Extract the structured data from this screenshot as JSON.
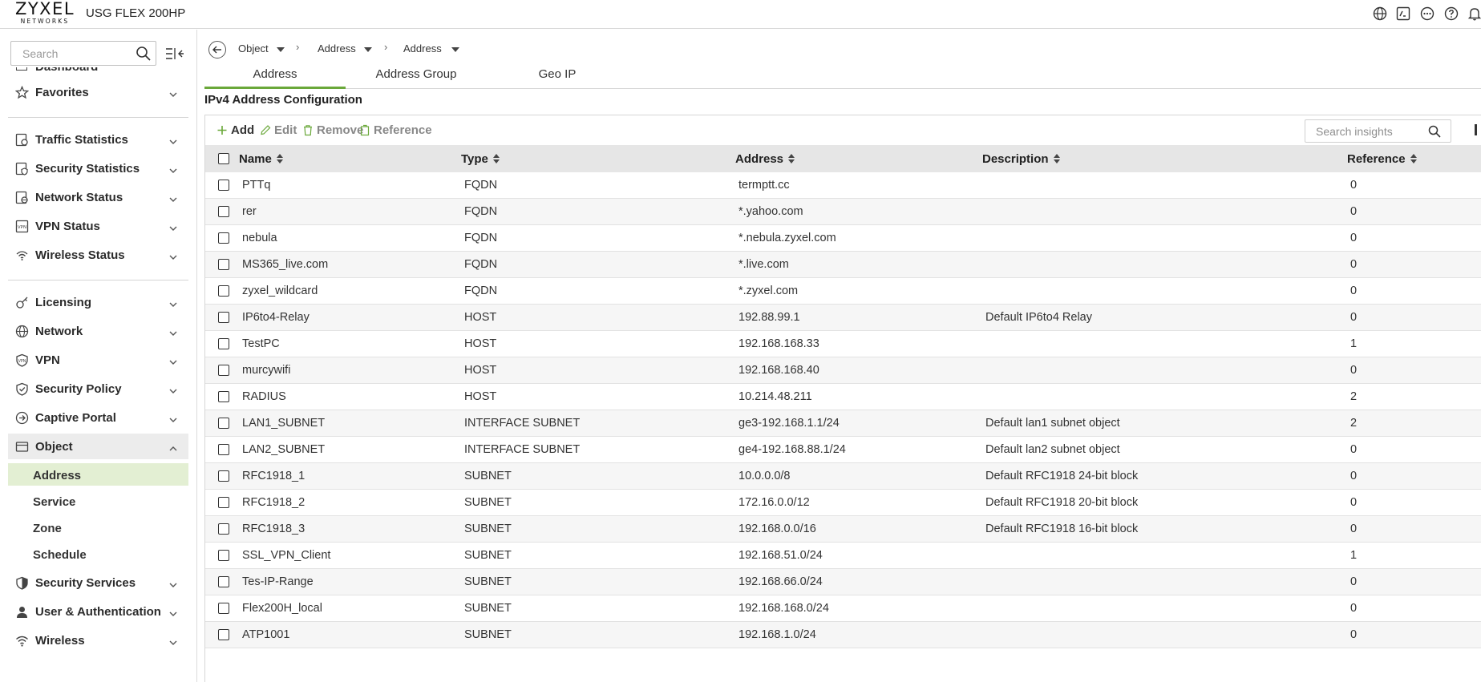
{
  "header": {
    "logo_main": "ZYXEL",
    "logo_sub": "NETWORKS",
    "product": "USG FLEX 200HP"
  },
  "sidebar": {
    "search_placeholder": "Search",
    "partial_item": "Dashboard",
    "items": [
      {
        "label": "Favorites",
        "icon": "star-icon"
      },
      {
        "label": "Traffic Statistics",
        "icon": "traffic-statistics-icon"
      },
      {
        "label": "Security Statistics",
        "icon": "security-statistics-icon"
      },
      {
        "label": "Network Status",
        "icon": "network-status-icon"
      },
      {
        "label": "VPN Status",
        "icon": "vpn-status-icon"
      },
      {
        "label": "Wireless Status",
        "icon": "wireless-status-icon"
      },
      {
        "label": "Licensing",
        "icon": "licensing-icon"
      },
      {
        "label": "Network",
        "icon": "globe-icon"
      },
      {
        "label": "VPN",
        "icon": "vpn-shield-icon"
      },
      {
        "label": "Security Policy",
        "icon": "security-policy-icon"
      },
      {
        "label": "Captive Portal",
        "icon": "captive-portal-icon"
      },
      {
        "label": "Object",
        "icon": "object-icon"
      },
      {
        "label": "Security Services",
        "icon": "security-services-icon"
      },
      {
        "label": "User & Authentication",
        "icon": "user-icon"
      },
      {
        "label": "Wireless",
        "icon": "wifi-icon"
      }
    ],
    "object_sub": [
      "Address",
      "Service",
      "Zone",
      "Schedule"
    ]
  },
  "breadcrumb": {
    "items": [
      "Object",
      "Address",
      "Address"
    ]
  },
  "tabs": [
    "Address",
    "Address Group",
    "Geo IP"
  ],
  "section_title": "IPv4 Address Configuration",
  "toolbar": {
    "add": "Add",
    "edit": "Edit",
    "remove": "Remove",
    "reference": "Reference",
    "search_placeholder": "Search insights"
  },
  "table": {
    "columns": [
      "Name",
      "Type",
      "Address",
      "Description",
      "Reference"
    ],
    "rows": [
      [
        "PTTq",
        "FQDN",
        "termptt.cc",
        "",
        "0"
      ],
      [
        "rer",
        "FQDN",
        "*.yahoo.com",
        "",
        "0"
      ],
      [
        "nebula",
        "FQDN",
        "*.nebula.zyxel.com",
        "",
        "0"
      ],
      [
        "MS365_live.com",
        "FQDN",
        "*.live.com",
        "",
        "0"
      ],
      [
        "zyxel_wildcard",
        "FQDN",
        "*.zyxel.com",
        "",
        "0"
      ],
      [
        "IP6to4-Relay",
        "HOST",
        "192.88.99.1",
        "Default IP6to4 Relay",
        "0"
      ],
      [
        "TestPC",
        "HOST",
        "192.168.168.33",
        "",
        "1"
      ],
      [
        "murcywifi",
        "HOST",
        "192.168.168.40",
        "",
        "0"
      ],
      [
        "RADIUS",
        "HOST",
        "10.214.48.211",
        "",
        "2"
      ],
      [
        "LAN1_SUBNET",
        "INTERFACE SUBNET",
        "ge3-192.168.1.1/24",
        "Default lan1 subnet object",
        "2"
      ],
      [
        "LAN2_SUBNET",
        "INTERFACE SUBNET",
        "ge4-192.168.88.1/24",
        "Default lan2 subnet object",
        "0"
      ],
      [
        "RFC1918_1",
        "SUBNET",
        "10.0.0.0/8",
        "Default RFC1918 24-bit block",
        "0"
      ],
      [
        "RFC1918_2",
        "SUBNET",
        "172.16.0.0/12",
        "Default RFC1918 20-bit block",
        "0"
      ],
      [
        "RFC1918_3",
        "SUBNET",
        "192.168.0.0/16",
        "Default RFC1918 16-bit block",
        "0"
      ],
      [
        "SSL_VPN_Client",
        "SUBNET",
        "192.168.51.0/24",
        "",
        "1"
      ],
      [
        "Tes-IP-Range",
        "SUBNET",
        "192.168.66.0/24",
        "",
        "0"
      ],
      [
        "Flex200H_local",
        "SUBNET",
        "192.168.168.0/24",
        "",
        "0"
      ],
      [
        "ATP1001",
        "SUBNET",
        "192.168.1.0/24",
        "",
        "0"
      ]
    ]
  },
  "colors": {
    "accent_green": "#6aa83a",
    "active_sub_bg": "#e3efd3",
    "header_bg": "#e6e6e6"
  }
}
